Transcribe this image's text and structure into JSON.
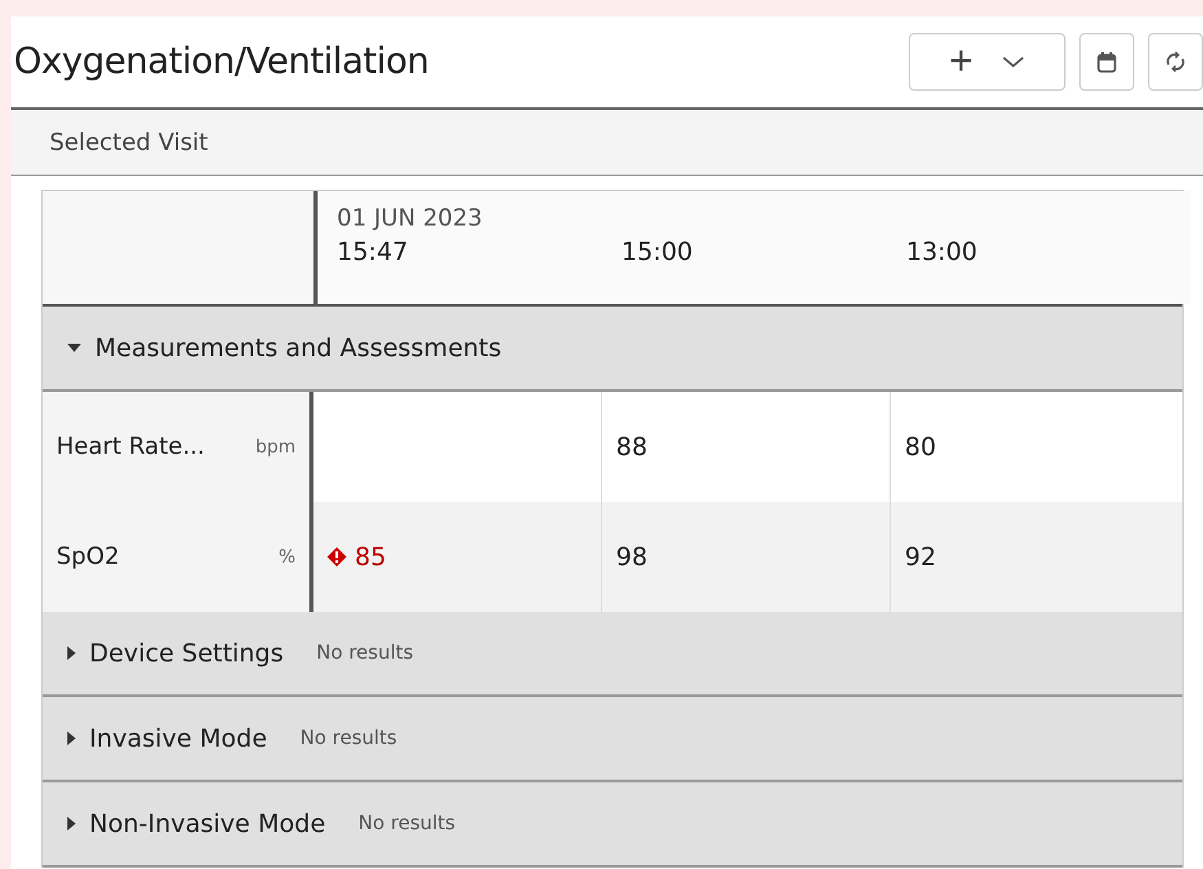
{
  "title": "Oxygenation/Ventilation",
  "toolbar": {
    "add": "+"
  },
  "filter": "Selected Visit",
  "table": {
    "date": "01 JUN 2023",
    "columns": [
      "15:47",
      "15:00",
      "13:00"
    ],
    "groups": [
      {
        "label": "Measurements and Assessments",
        "expanded": true,
        "rows": [
          {
            "name": "Heart Rate...",
            "unit": "bpm",
            "cells": [
              {},
              {
                "value": "88"
              },
              {
                "value": "80"
              }
            ]
          },
          {
            "name": "SpO2",
            "unit": "%",
            "cells": [
              {
                "value": "85",
                "alert": true
              },
              {
                "value": "98"
              },
              {
                "value": "92"
              }
            ]
          }
        ]
      },
      {
        "label": "Device Settings",
        "expanded": false,
        "note": "No results"
      },
      {
        "label": "Invasive Mode",
        "expanded": false,
        "note": "No results"
      },
      {
        "label": "Non-Invasive Mode",
        "expanded": false,
        "note": "No results"
      }
    ]
  }
}
